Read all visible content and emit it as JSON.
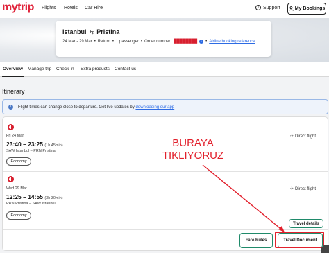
{
  "brand": {
    "logo": "mytrip",
    "accent": "#e0243b"
  },
  "topnav": {
    "links": [
      "Flights",
      "Hotels",
      "Car Hire"
    ],
    "support_label": "Support",
    "bookings_label": "My Bookings"
  },
  "booking": {
    "origin": "Istanbul",
    "destination": "Pristina",
    "dates": "24 Mar - 29 Mar",
    "trip_type": "Return",
    "passengers": "1 passenger",
    "order_label": "Order number:",
    "order_number": "████████",
    "airline_ref_label": "Airline booking reference"
  },
  "tabs": [
    "Overview",
    "Manage trip",
    "Check-in",
    "Extra products",
    "Contact us"
  ],
  "itinerary": {
    "title": "Itinerary",
    "alert_text": "Flight times can change close to departure. Get live updates by",
    "alert_link": "downloading our app"
  },
  "flights": [
    {
      "date": "Fri 24 Mar",
      "times": "23:40 – 23:25",
      "duration": "(1h 45min)",
      "route": "SAW Istanbul – PRN Pristina",
      "cabin": "Economy",
      "stops": "Direct flight"
    },
    {
      "date": "Wed 29 Mar",
      "times": "12:25 – 14:55",
      "duration": "(3h 30min)",
      "route": "PRN Pristina – SAW Istanbul",
      "cabin": "Economy",
      "stops": "Direct flight"
    }
  ],
  "actions": {
    "travel_details": "Travel details",
    "fare_rules": "Fare Rules",
    "travel_document": "Travel Document"
  },
  "annotation": {
    "line1": "BURAYA",
    "line2": "TIKLIYORUZ",
    "color": "#e2202c"
  }
}
